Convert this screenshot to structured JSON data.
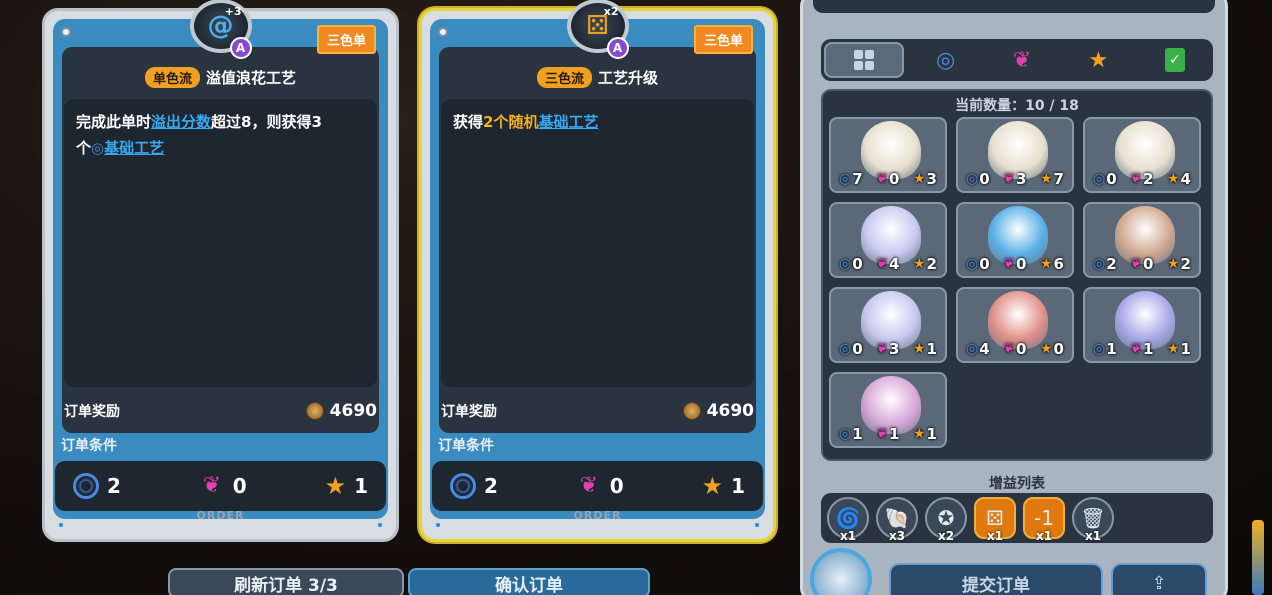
{
  "cards": [
    {
      "badge": "三色单",
      "tag": "单色流",
      "title": "溢值浪花工艺",
      "emblem_sup": "+3",
      "desc_pre": "完成此单时",
      "desc_link1": "溢出分数",
      "desc_mid": "超过8，则获得3",
      "desc_line2_pre": "个",
      "desc_link2": "基础工艺",
      "reward_label": "订单奖励",
      "reward_value": "4690",
      "cond_label": "订单条件",
      "cond": {
        "swirl": "2",
        "shell": "0",
        "star": "1"
      },
      "footer": "ORDER"
    },
    {
      "badge": "三色单",
      "tag": "三色流",
      "title": "工艺升级",
      "emblem_sup": "x2",
      "desc_pre": "获得",
      "desc_hl": "2个随机",
      "desc_link1": "基础工艺",
      "reward_label": "订单奖励",
      "reward_value": "4690",
      "cond_label": "订单条件",
      "cond": {
        "swirl": "2",
        "shell": "0",
        "star": "1"
      },
      "footer": "ORDER"
    }
  ],
  "buttons": {
    "refresh": "刷新订单 3/3",
    "confirm": "确认订单",
    "submit": "提交订单"
  },
  "panel": {
    "count_label": "当前数量：10 / 18",
    "buff_title": "增益列表",
    "tabs": [
      "grid-icon",
      "swirl-icon",
      "shell-icon",
      "star-icon",
      "clipboard-check-icon"
    ],
    "shells": [
      {
        "kind": "conch-white",
        "b": "7",
        "p": "0",
        "y": "3",
        "color": "#e8e0d0"
      },
      {
        "kind": "conch-white",
        "b": "0",
        "p": "3",
        "y": "7",
        "color": "#e8e0d0"
      },
      {
        "kind": "conch-white",
        "b": "0",
        "p": "2",
        "y": "4",
        "color": "#e8e0d0"
      },
      {
        "kind": "cowrie-lilac",
        "b": "0",
        "p": "4",
        "y": "2",
        "color": "#c8c8f0"
      },
      {
        "kind": "scallop-blue",
        "b": "0",
        "p": "0",
        "y": "6",
        "color": "#5ab0e8"
      },
      {
        "kind": "spiral-brown",
        "b": "2",
        "p": "0",
        "y": "2",
        "color": "#d0a890"
      },
      {
        "kind": "cowrie-lilac",
        "b": "0",
        "p": "3",
        "y": "1",
        "color": "#c8c8f0"
      },
      {
        "kind": "clam-pink",
        "b": "4",
        "p": "0",
        "y": "0",
        "color": "#e09088"
      },
      {
        "kind": "bottlecap-purple",
        "b": "1",
        "p": "1",
        "y": "1",
        "color": "#a8a8e8"
      },
      {
        "kind": "bottlecap-pink",
        "b": "1",
        "p": "1",
        "y": "1",
        "color": "#d8a8d8"
      }
    ],
    "buffs": [
      {
        "icon": "swirl-plus-icon",
        "glyph": "🌀",
        "count": "x1",
        "orange": false
      },
      {
        "icon": "shell-plus-icon",
        "glyph": "🐚",
        "count": "x3",
        "orange": false
      },
      {
        "icon": "star-plus-icon",
        "glyph": "✪",
        "count": "x2",
        "orange": false
      },
      {
        "icon": "dice-icon",
        "glyph": "⚄",
        "count": "x1",
        "orange": true
      },
      {
        "icon": "minus-one-icon",
        "glyph": "-1",
        "count": "x1",
        "orange": true
      },
      {
        "icon": "trash-icon",
        "glyph": "🗑",
        "count": "x1",
        "orange": false
      }
    ]
  }
}
